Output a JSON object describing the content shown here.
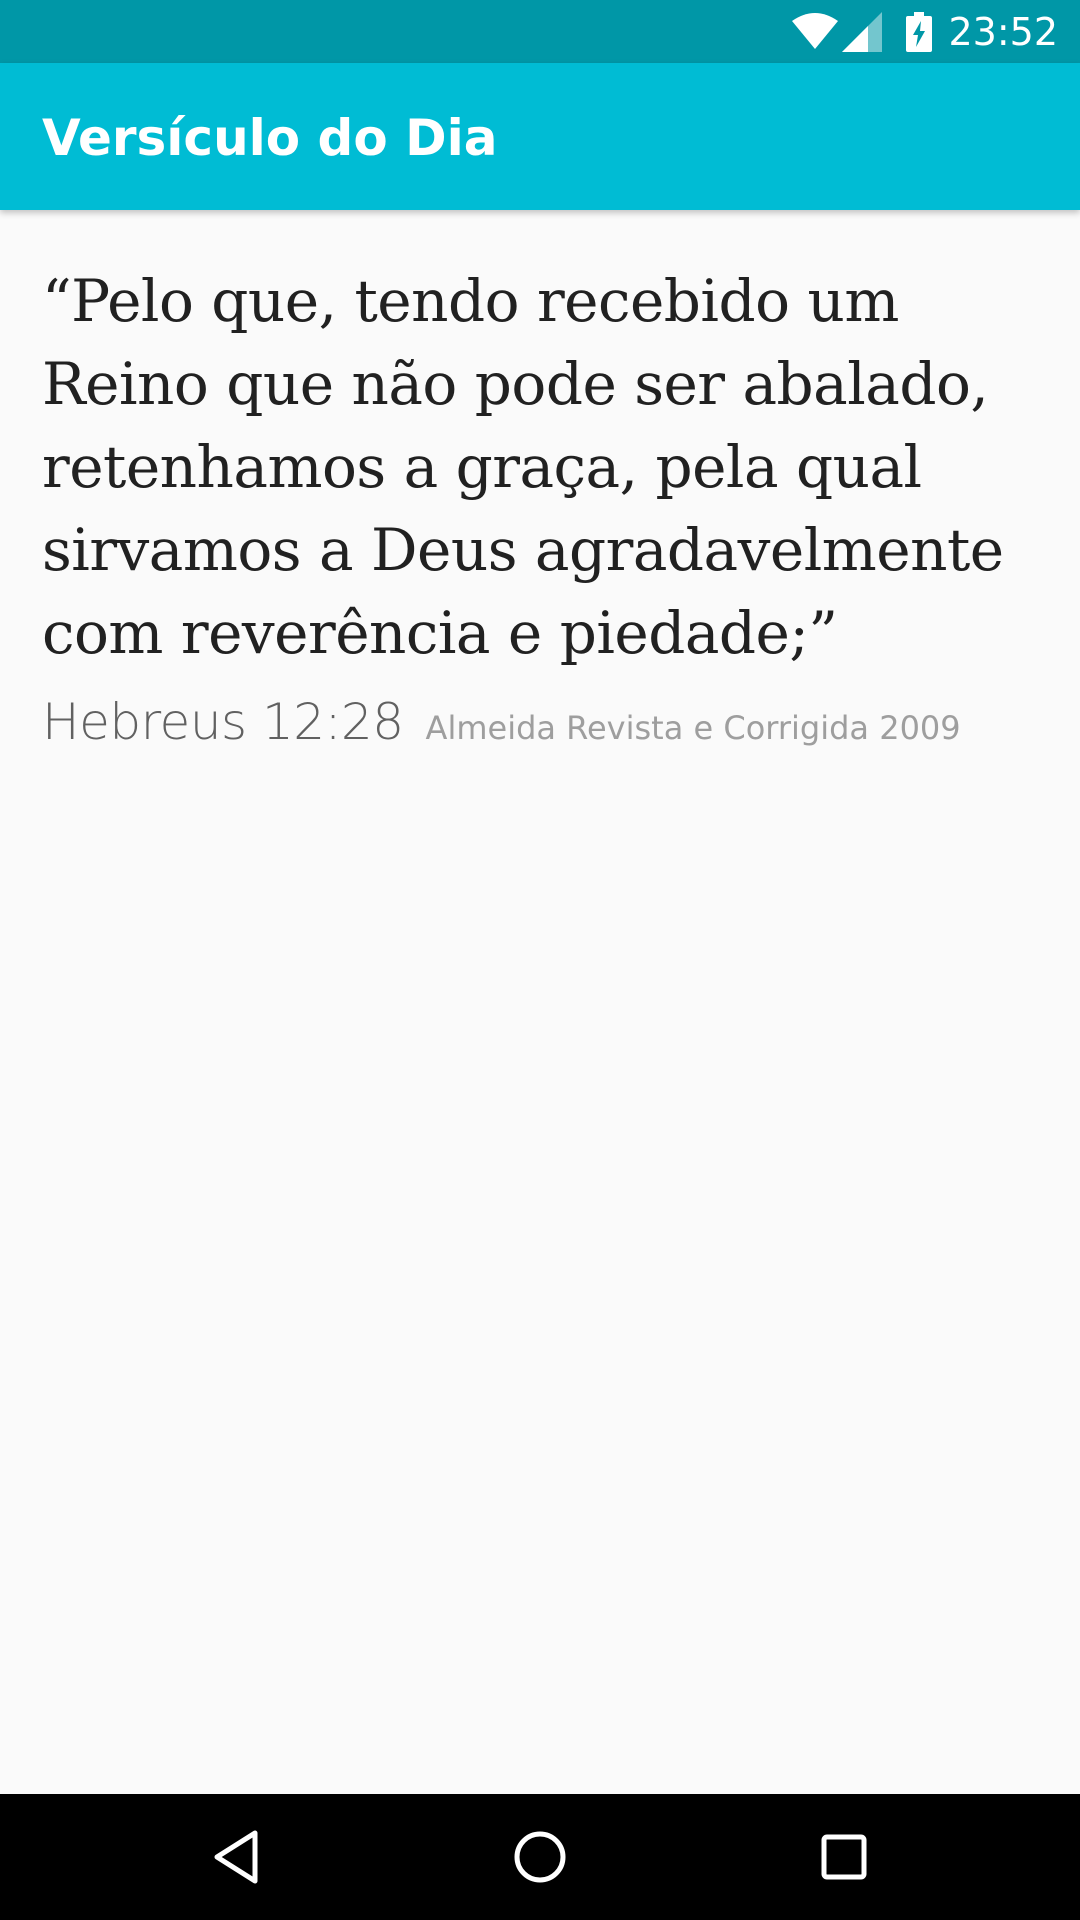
{
  "status_bar": {
    "time": "23:52",
    "icons": [
      "wifi-icon",
      "cell-signal-icon",
      "battery-charging-icon"
    ],
    "background_color": "#0097a7"
  },
  "app_bar": {
    "title": "Versículo do Dia",
    "background_color": "#00bcd4"
  },
  "verse": {
    "text": "“Pelo que, tendo recebido um Reino que não pode ser abalado, retenhamos a graça, pela qual sirvamos a Deus agradavelmente com reverência e piedade;”",
    "reference": "Hebreus 12:28",
    "version": "Almeida Revista e Corrigida 2009"
  },
  "nav_bar": {
    "buttons": [
      "back-icon",
      "home-icon",
      "recents-icon"
    ]
  }
}
